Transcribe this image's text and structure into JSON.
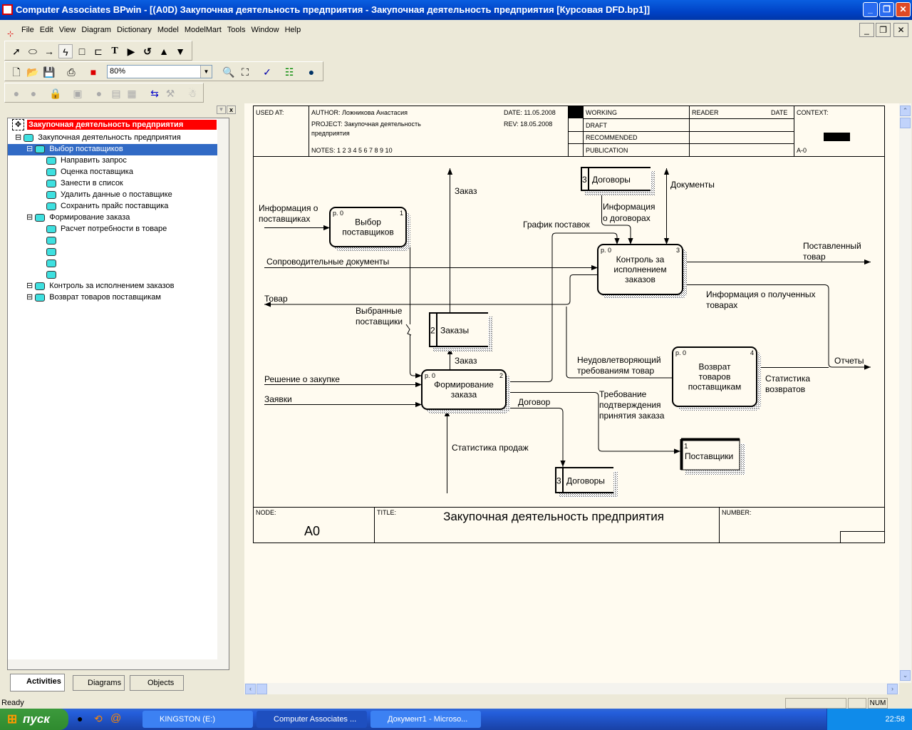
{
  "window": {
    "title": "Computer Associates BPwin - [(A0D) Закупочная деятельность  предприятия - Закупочная деятельность предприятия  [Курсовая DFD.bp1]]"
  },
  "menu": [
    "File",
    "Edit",
    "View",
    "Diagram",
    "Dictionary",
    "Model",
    "ModelMart",
    "Tools",
    "Window",
    "Help"
  ],
  "toolbar": {
    "zoom": "80%"
  },
  "tree": {
    "root": "Закупочная деятельность предприятия",
    "items": [
      {
        "label": "Закупочная деятельность  предприятия",
        "level": 0
      },
      {
        "label": "Выбор  поставщиков",
        "level": 1,
        "selected": true
      },
      {
        "label": "Направить  запрос",
        "level": 2
      },
      {
        "label": "Оценка  поставщика",
        "level": 2
      },
      {
        "label": "Занести в список",
        "level": 2
      },
      {
        "label": "Удалить  данные о  поставщике",
        "level": 2
      },
      {
        "label": "Сохранить  прайс  поставщика",
        "level": 2
      },
      {
        "label": "Формирование  заказа",
        "level": 1
      },
      {
        "label": "Расчет  потребности  в товаре",
        "level": 2
      },
      {
        "label": "",
        "level": 2
      },
      {
        "label": "",
        "level": 2
      },
      {
        "label": "",
        "level": 2
      },
      {
        "label": "",
        "level": 2
      },
      {
        "label": "Контроль за  исполнением  заказов",
        "level": 1
      },
      {
        "label": "Возврат  товаров  поставщикам",
        "level": 1
      }
    ]
  },
  "tabs": [
    "Activities",
    "Diagrams",
    "Objects"
  ],
  "frame": {
    "used_at": "USED AT:",
    "author": "AUTHOR:  Ложникова Анастасия",
    "project": "PROJECT:  Закупочная деятельность",
    "project2": "предприятия",
    "notes": "NOTES:  1  2  3  4  5  6  7  8  9  10",
    "date": "DATE:  11.05.2008",
    "rev": "REV:    18.05.2008",
    "working": "WORKING",
    "draft": "DRAFT",
    "recommended": "RECOMMENDED",
    "publication": "PUBLICATION",
    "reader": "READER",
    "reader_date": "DATE",
    "context": "CONTEXT:",
    "context_node": "A-0",
    "node_label": "NODE:",
    "node": "A0",
    "title_label": "TITLE:",
    "title": "Закупочная деятельность  предприятия",
    "number_label": "NUMBER:"
  },
  "processes": [
    {
      "ref": "р. 0",
      "num": "1",
      "l1": "Выбор",
      "l2": "поставщиков"
    },
    {
      "ref": "р. 0",
      "num": "2",
      "l1": "Формирование",
      "l2": "заказа"
    },
    {
      "ref": "р. 0",
      "num": "3",
      "l1": "Контроль за",
      "l2": "исполнением",
      "l3": "заказов"
    },
    {
      "ref": "р. 0",
      "num": "4",
      "l1": "Возврат",
      "l2": "товаров",
      "l3": "поставщикам"
    }
  ],
  "stores": [
    {
      "num": "3",
      "name": "Договоры"
    },
    {
      "num": "2",
      "name": "Заказы"
    },
    {
      "num": "3",
      "name": "Договоры"
    }
  ],
  "external": {
    "num": "1",
    "name": "Поставщики"
  },
  "arrows": {
    "info_sup1": "Информация о",
    "info_sup2": "поставщиках",
    "accomp": "Сопроводительные документы",
    "goods": "Товар",
    "order_up": "Заказ",
    "chosen1": "Выбранные",
    "chosen2": "поставщики",
    "order2": "Заказ",
    "decision": "Решение о закупке",
    "requests": "Заявки",
    "sales": "Статистика продаж",
    "contract": "Договор",
    "req1": "Требование",
    "req2": "подтверждения",
    "req3": "принятия заказа",
    "schedule": "График поставок",
    "infocon1": "Информация",
    "infocon2": "о договорах",
    "docs": "Документы",
    "delivered1": "Поставленный",
    "delivered2": "товар",
    "inforec1": "Информация о полученных",
    "inforec2": "товарах",
    "bad1": "Неудовлетворяющий",
    "bad2": "требованиям товар",
    "reports": "Отчеты",
    "retstat1": "Статистика",
    "retstat2": "возвратов"
  },
  "status": {
    "text": "Ready",
    "num": "NUM"
  },
  "taskbar": {
    "start": "пуск",
    "tasks": [
      "KINGSTON (E:)",
      "Computer Associates ...",
      "Документ1 - Microso..."
    ],
    "clock": "22:58"
  }
}
